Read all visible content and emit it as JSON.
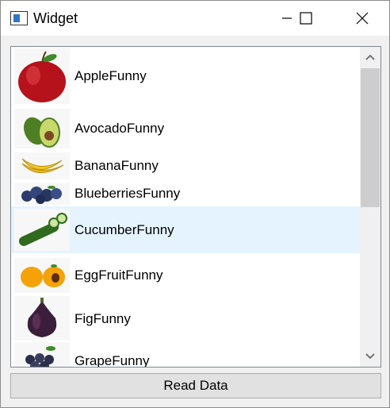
{
  "window": {
    "title": "Widget",
    "minimize_icon": "minimize-icon",
    "maximize_icon": "maximize-icon",
    "close_icon": "close-icon"
  },
  "list": {
    "items": [
      {
        "label": "AppleFunny",
        "icon": "apple-image"
      },
      {
        "label": "AvocadoFunny",
        "icon": "avocado-image"
      },
      {
        "label": "BananaFunny",
        "icon": "banana-image"
      },
      {
        "label": "BlueberriesFunny",
        "icon": "blueberries-image"
      },
      {
        "label": "CucumberFunny",
        "icon": "cucumber-image",
        "selected": true
      },
      {
        "label": "EggFruitFunny",
        "icon": "eggfruit-image"
      },
      {
        "label": "FigFunny",
        "icon": "fig-image"
      },
      {
        "label": "GrapeFunny",
        "icon": "grape-image"
      }
    ],
    "selected_color": "#e5f3ff"
  },
  "footer": {
    "read_button_label": "Read Data"
  }
}
